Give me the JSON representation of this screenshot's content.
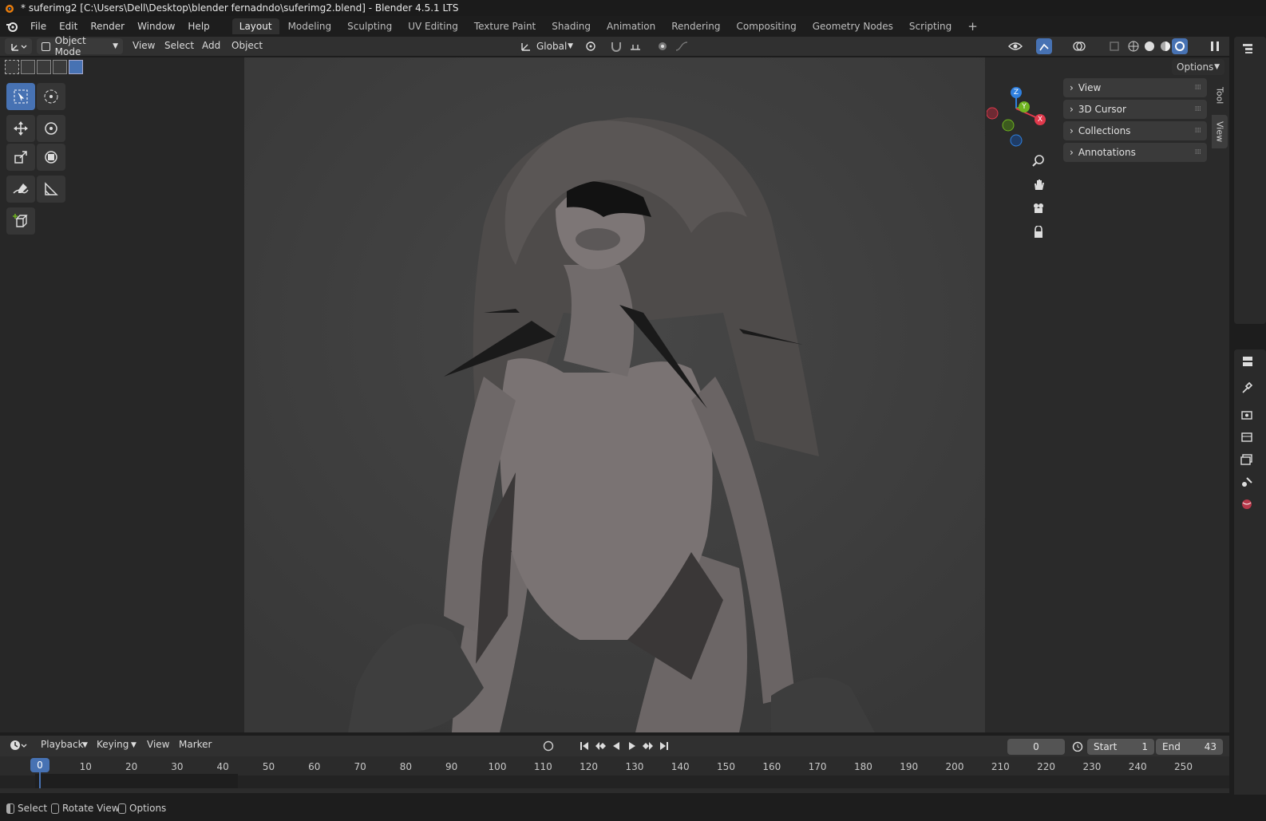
{
  "window": {
    "title": "* suferimg2 [C:\\Users\\Dell\\Desktop\\blender fernadndo\\suferimg2.blend] - Blender 4.5.1 LTS"
  },
  "menu": {
    "items": [
      "File",
      "Edit",
      "Render",
      "Window",
      "Help"
    ]
  },
  "workspaces": {
    "tabs": [
      "Layout",
      "Modeling",
      "Sculpting",
      "UV Editing",
      "Texture Paint",
      "Shading",
      "Animation",
      "Rendering",
      "Compositing",
      "Geometry Nodes",
      "Scripting"
    ],
    "add": "+",
    "active": "Layout"
  },
  "header": {
    "mode": "Object Mode",
    "view": "View",
    "select": "Select",
    "add": "Add",
    "object": "Object",
    "transform_orientation": "Global",
    "options": "Options"
  },
  "gizmo": {
    "x": "X",
    "y": "Y",
    "z": "Z"
  },
  "npanel": {
    "panels": [
      "View",
      "3D Cursor",
      "Collections",
      "Annotations"
    ],
    "tabs": [
      "Tool",
      "View"
    ]
  },
  "timeline": {
    "menus": [
      "Playback",
      "Keying",
      "View",
      "Marker"
    ],
    "current_frame": "0",
    "start_label": "Start",
    "start": "1",
    "end_label": "End",
    "end": "43",
    "playhead": "0",
    "ruler": [
      "10",
      "20",
      "30",
      "40",
      "50",
      "60",
      "70",
      "80",
      "90",
      "100",
      "110",
      "120",
      "130",
      "140",
      "150",
      "160",
      "170",
      "180",
      "190",
      "200",
      "210",
      "220",
      "230",
      "240",
      "250"
    ]
  },
  "status": {
    "select": "Select",
    "rotate": "Rotate View",
    "options": "Options"
  },
  "colors": {
    "accent": "#4772b3",
    "x_axis": "#e0394c",
    "y_axis": "#6fb320",
    "z_axis": "#2f80e0"
  }
}
